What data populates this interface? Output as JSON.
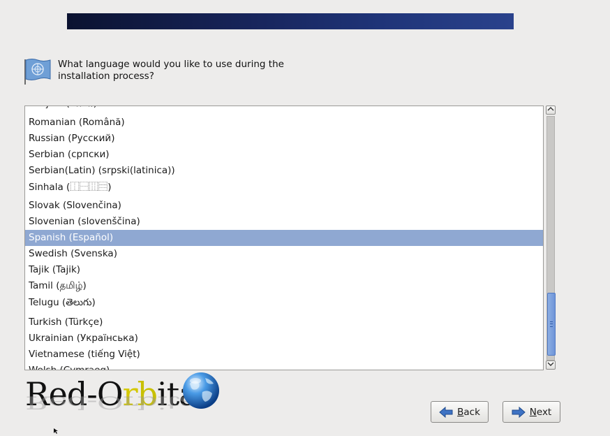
{
  "question": "What language would you like to use during the installation process?",
  "languages": [
    {
      "label": "Punjabi (ਪੰਜਾਬੀ)",
      "selected": false
    },
    {
      "label": "Romanian (Română)",
      "selected": false
    },
    {
      "label": "Russian (Русский)",
      "selected": false
    },
    {
      "label": "Serbian (српски)",
      "selected": false
    },
    {
      "label": "Serbian(Latin) (srpski(latinica))",
      "selected": false
    },
    {
      "label": "Sinhala (⿰⿱⿲⿳)",
      "selected": false
    },
    {
      "label": "Slovak (Slovenčina)",
      "selected": false
    },
    {
      "label": "Slovenian (slovenščina)",
      "selected": false
    },
    {
      "label": "Spanish (Español)",
      "selected": true
    },
    {
      "label": "Swedish (Svenska)",
      "selected": false
    },
    {
      "label": "Tajik (Tajik)",
      "selected": false
    },
    {
      "label": "Tamil (தமிழ்)",
      "selected": false
    },
    {
      "label": "Telugu (తెలుగు)",
      "selected": false
    },
    {
      "label": "Turkish (Türkçe)",
      "selected": false
    },
    {
      "label": "Ukrainian (Українська)",
      "selected": false
    },
    {
      "label": "Vietnamese (tiếng Việt)",
      "selected": false
    },
    {
      "label": "Welsh (Cymraeg)",
      "selected": false
    }
  ],
  "buttons": {
    "back_label": "Back",
    "next_label": "Next"
  },
  "logo": {
    "text_part1": "Red-O",
    "text_part2": "r",
    "text_part3": "b",
    "text_part4": "ita"
  },
  "colors": {
    "selection": "#8fa8d2",
    "banner": "#17245a",
    "scroll_thumb": "#7aa0dd"
  },
  "scroll_position": 0.85
}
